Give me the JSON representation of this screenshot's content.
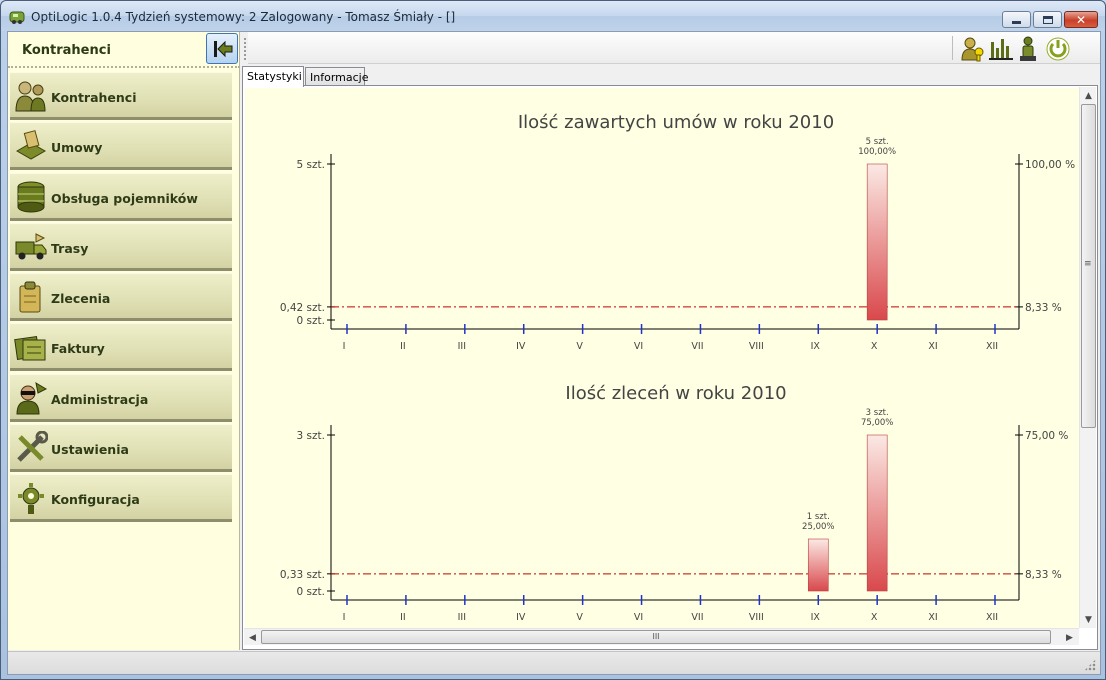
{
  "window": {
    "title": "OptiLogic 1.0.4  Tydzień systemowy: 2  Zalogowany - Tomasz Śmiały - []",
    "minimize_icon": "minimize-icon",
    "maximize_icon": "maximize-icon",
    "close_icon": "close-icon"
  },
  "sidebar": {
    "title": "Kontrahenci",
    "collapse_icon": "collapse-left-arrow-icon",
    "items": [
      {
        "label": "Kontrahenci",
        "icon": "contractors-icon"
      },
      {
        "label": "Umowy",
        "icon": "contracts-icon"
      },
      {
        "label": "Obsługa pojemników",
        "icon": "containers-icon"
      },
      {
        "label": "Trasy",
        "icon": "routes-truck-icon"
      },
      {
        "label": "Zlecenia",
        "icon": "orders-icon"
      },
      {
        "label": "Faktury",
        "icon": "invoices-icon"
      },
      {
        "label": "Administracja",
        "icon": "administration-icon"
      },
      {
        "label": "Ustawienia",
        "icon": "settings-tools-icon"
      },
      {
        "label": "Konfiguracja",
        "icon": "configuration-gear-icon"
      }
    ]
  },
  "toolbar": {
    "icons": [
      "user-key-icon",
      "bar-chart-icon",
      "info-person-icon",
      "power-icon"
    ]
  },
  "tabs": [
    {
      "label": "Statystyki",
      "active": true
    },
    {
      "label": "Informacje",
      "active": false
    }
  ],
  "colors": {
    "chart_background": "#ffffe3",
    "bar_fill_top": "#fbe9e4",
    "bar_fill_bottom": "#d9484c",
    "avg_line": "#c00000",
    "tick_marks": "#2233cc",
    "sidebar_background": "#ffffdf"
  },
  "chart_data": [
    {
      "type": "bar",
      "title": "Ilość zawartych umów w roku 2010",
      "categories": [
        "I",
        "II",
        "III",
        "IV",
        "V",
        "VI",
        "VII",
        "VIII",
        "IX",
        "X",
        "XI",
        "XII"
      ],
      "values": [
        0,
        0,
        0,
        0,
        0,
        0,
        0,
        0,
        0,
        5,
        0,
        0
      ],
      "bar_labels": [
        "",
        "",
        "",
        "",
        "",
        "",
        "",
        "",
        "",
        "5 szt.|100,00%",
        "",
        ""
      ],
      "ylim": [
        0,
        5
      ],
      "y_ticks_left": [
        {
          "value": 0,
          "label": "0 szt."
        },
        {
          "value": 0.42,
          "label": "0,42 szt."
        },
        {
          "value": 5,
          "label": "5 szt."
        }
      ],
      "y_ticks_right": [
        {
          "value": 0.42,
          "label": "8,33 %"
        },
        {
          "value": 5,
          "label": "100,00 %"
        }
      ],
      "average": 0.42
    },
    {
      "type": "bar",
      "title": "Ilość zleceń w roku 2010",
      "categories": [
        "I",
        "II",
        "III",
        "IV",
        "V",
        "VI",
        "VII",
        "VIII",
        "IX",
        "X",
        "XI",
        "XII"
      ],
      "values": [
        0,
        0,
        0,
        0,
        0,
        0,
        0,
        0,
        1,
        3,
        0,
        0
      ],
      "bar_labels": [
        "",
        "",
        "",
        "",
        "",
        "",
        "",
        "",
        "1 szt.|25,00%",
        "3 szt.|75,00%",
        "",
        ""
      ],
      "ylim": [
        0,
        3
      ],
      "y_ticks_left": [
        {
          "value": 0,
          "label": "0 szt."
        },
        {
          "value": 0.33,
          "label": "0,33 szt."
        },
        {
          "value": 3,
          "label": "3 szt."
        }
      ],
      "y_ticks_right": [
        {
          "value": 0.33,
          "label": "8,33 %"
        },
        {
          "value": 3,
          "label": "75,00 %"
        }
      ],
      "average": 0.33
    }
  ],
  "scrollbars": {
    "h_grip": "III",
    "v_grip": "≡"
  }
}
